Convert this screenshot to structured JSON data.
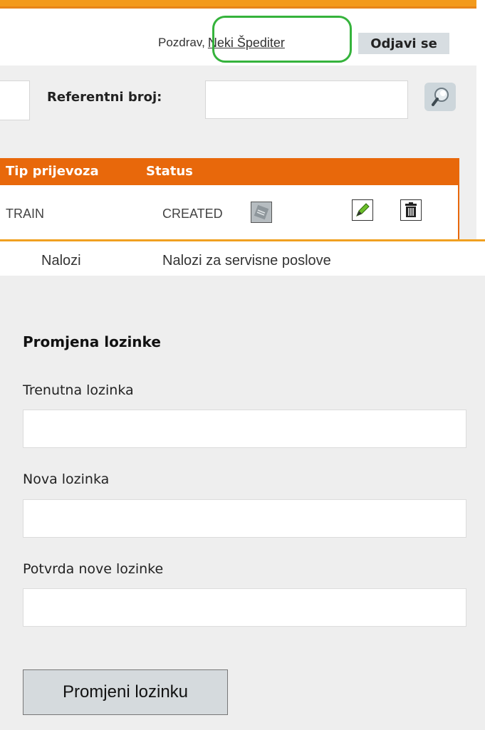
{
  "header": {
    "greeting_prefix": "Pozdrav,",
    "username": "Neki Špediter",
    "logout_label": "Odjavi se"
  },
  "search": {
    "ref_label": "Referentni broj:",
    "ref_value": ""
  },
  "orders_table": {
    "columns": [
      "Tip prijevoza",
      "Status"
    ],
    "rows": [
      {
        "transport_type": "TRAIN",
        "status": "CREATED"
      }
    ]
  },
  "nav": {
    "items": [
      {
        "label": "Nalozi"
      },
      {
        "label": "Nalozi za servisne poslove"
      }
    ]
  },
  "password_form": {
    "title": "Promjena lozinke",
    "current_label": "Trenutna lozinka",
    "new_label": "Nova lozinka",
    "confirm_label": "Potvrda nove lozinke",
    "submit_label": "Promjeni lozinku"
  },
  "colors": {
    "accent_orange": "#e8680b",
    "highlight_green": "#35b33c",
    "button_bg": "#d5dadd"
  }
}
